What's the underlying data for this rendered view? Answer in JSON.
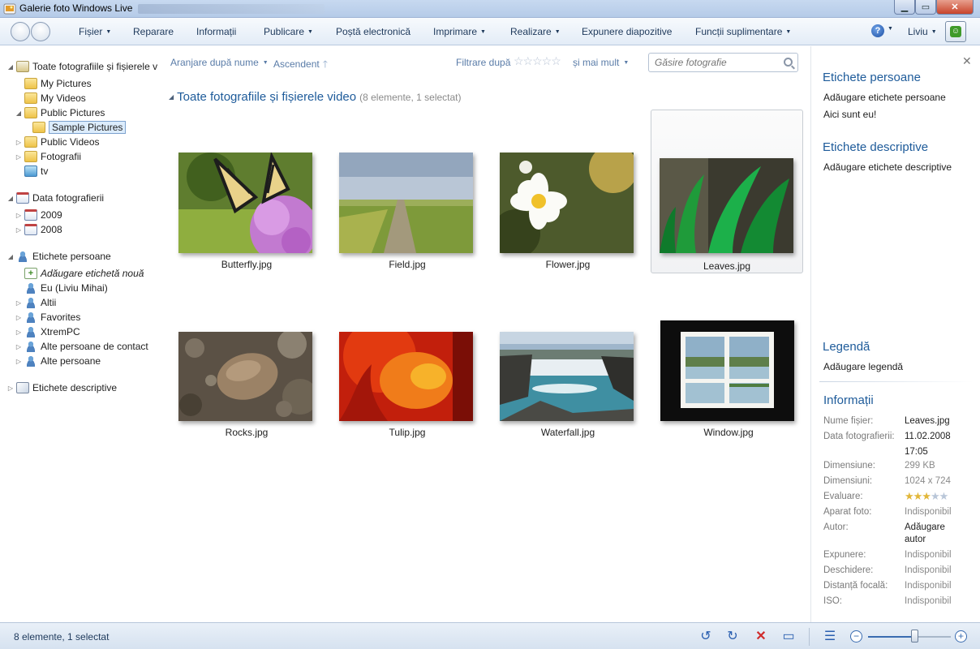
{
  "window": {
    "title": "Galerie foto Windows Live"
  },
  "toolbar": {
    "menus": [
      "Fișier",
      "Reparare",
      "Informații",
      "Publicare",
      "Poștă electronică",
      "Imprimare",
      "Realizare",
      "Expunere diapozitive",
      "Funcții suplimentare"
    ],
    "user": "Liviu"
  },
  "sidebar": {
    "all": "Toate fotografiile și fișierele v",
    "my_pictures": "My Pictures",
    "my_videos": "My Videos",
    "public_pictures": "Public Pictures",
    "sample_pictures": "Sample Pictures",
    "public_videos": "Public Videos",
    "fotografii": "Fotografii",
    "tv": "tv",
    "date_taken": "Data fotografierii",
    "year_2009": "2009",
    "year_2008": "2008",
    "people_tags": "Etichete persoane",
    "add_tag": "Adăugare etichetă nouă",
    "me": "Eu (Liviu Mihai)",
    "altii": "Altii",
    "favorites": "Favorites",
    "xtremepc": "XtremPC",
    "other_contacts": "Alte persoane de contact",
    "other_people": "Alte persoane",
    "descriptive_tags": "Etichete descriptive"
  },
  "sortbar": {
    "arrange": "Aranjare după nume",
    "order": "Ascendent",
    "filter": "Filtrare după",
    "filter_stars": "☆☆☆☆☆",
    "more": "și mai mult",
    "search_placeholder": "Găsire fotografie"
  },
  "gallery": {
    "title": "Toate fotografiile și fișierele video",
    "count": "(8 elemente, 1 selectat)",
    "items": [
      {
        "name": "Butterfly.jpg"
      },
      {
        "name": "Field.jpg"
      },
      {
        "name": "Flower.jpg"
      },
      {
        "name": "Leaves.jpg",
        "selected": true
      },
      {
        "name": "Rocks.jpg"
      },
      {
        "name": "Tulip.jpg"
      },
      {
        "name": "Waterfall.jpg"
      },
      {
        "name": "Window.jpg"
      }
    ]
  },
  "details": {
    "people_head": "Etichete persoane",
    "people_add": "Adăugare etichete persoane",
    "people_me": "Aici sunt eu!",
    "desc_head": "Etichete descriptive",
    "desc_add": "Adăugare etichete descriptive",
    "caption_head": "Legendă",
    "caption_add": "Adăugare legendă",
    "info_head": "Informații",
    "labels": {
      "filename": "Nume fișier:",
      "date": "Data fotografierii:",
      "size": "Dimensiune:",
      "dimensions": "Dimensiuni:",
      "rating": "Evaluare:",
      "camera": "Aparat foto:",
      "author": "Autor:",
      "exposure": "Expunere:",
      "aperture": "Deschidere:",
      "focal": "Distanță focală:",
      "iso": "ISO:"
    },
    "values": {
      "filename": "Leaves.jpg",
      "date": "11.02.2008",
      "time": "17:05",
      "size": "299 KB",
      "dimensions": "1024 x 724",
      "rating_on": "★★★",
      "rating_off": "★★",
      "camera": "Indisponibil",
      "author_1": "Adăugare",
      "author_2": "autor",
      "exposure": "Indisponibil",
      "aperture": "Indisponibil",
      "focal": "Indisponibil",
      "iso": "Indisponibil"
    },
    "rating": 3
  },
  "status": {
    "text": "8 elemente, 1 selectat",
    "zoom_level": 0.56
  },
  "colors": {
    "accent": "#1e5b9a",
    "link": "#5a7ca8",
    "delete": "#d02c2c"
  }
}
